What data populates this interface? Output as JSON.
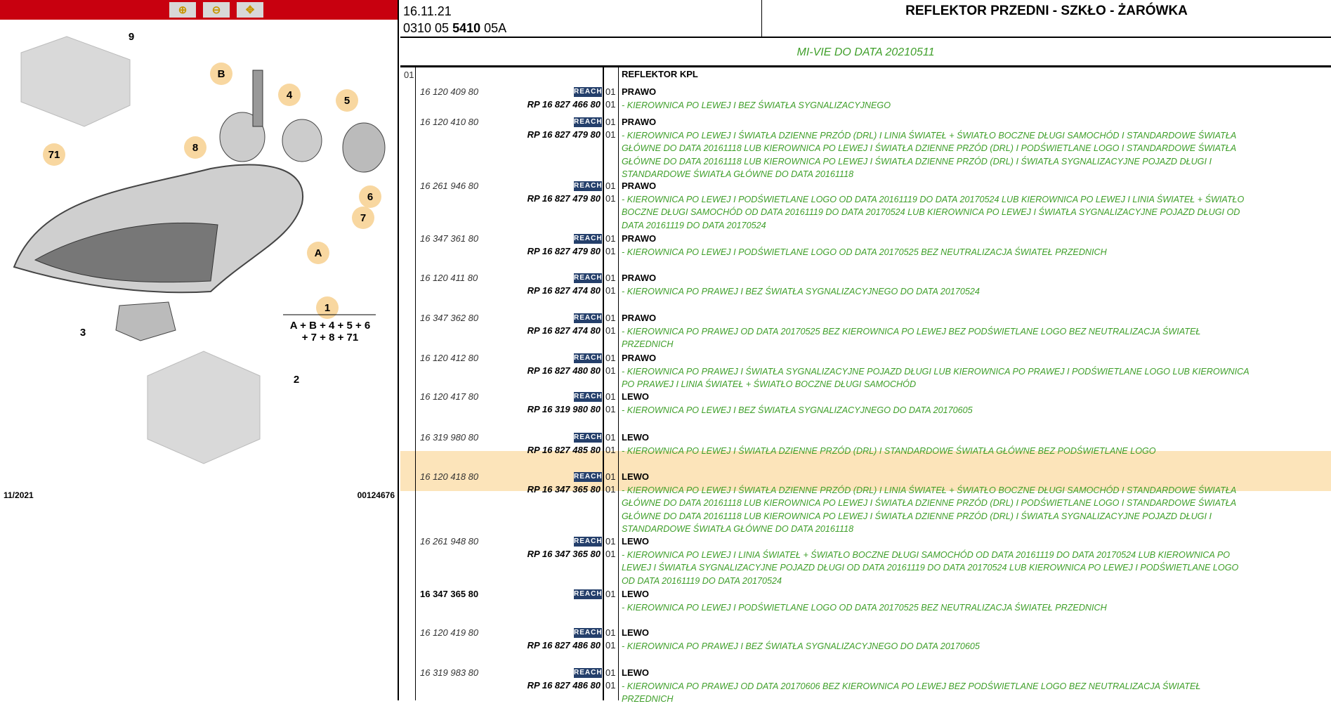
{
  "toolbar": {
    "zoom_in": "zoom-in-icon",
    "zoom_out": "zoom-out-icon",
    "pan": "pan-zoom-icon"
  },
  "diagram": {
    "callouts": [
      "9",
      "B",
      "4",
      "5",
      "71",
      "8",
      "6",
      "7",
      "A",
      "1",
      "3",
      "2"
    ],
    "formula_line1": "A + B + 4 + 5 + 6",
    "formula_line2": "+ 7 + 8 + 71",
    "date": "11/2021",
    "code": "00124676"
  },
  "header": {
    "date": "16.11.21",
    "ref_prefix": "0310 05 ",
    "ref_bold": "5410",
    "ref_suffix": " 05A",
    "title": "REFLEKTOR PRZEDNI - SZKŁO - ŻARÓWKA",
    "subtitle": "MI-VIE DO DATA 20210511"
  },
  "table": {
    "level": "01",
    "group": "REFLEKTOR KPL",
    "reach": "REACH",
    "highlight_color": "#fce4ba",
    "entries": [
      {
        "pn": "16 120 409 80",
        "qty": "01",
        "side": "PRAWO",
        "rp": "RP 16 827 466 80",
        "rqty": "01",
        "desc": [
          "- KIEROWNICA PO LEWEJ I BEZ ŚWIATŁA SYGNALIZACYJNEGO"
        ]
      },
      {
        "pn": "16 120 410 80",
        "qty": "01",
        "side": "PRAWO",
        "rp": "RP 16 827 479 80",
        "rqty": "01",
        "desc": [
          "- KIEROWNICA PO LEWEJ I ŚWIATŁA DZIENNE PRZÓD (DRL) I LINIA ŚWIATEŁ + ŚWIATŁO BOCZNE DŁUGI SAMOCHÓD I STANDARDOWE ŚWIATŁA",
          "GŁÓWNE DO DATA 20161118 LUB KIEROWNICA PO LEWEJ I ŚWIATŁA DZIENNE PRZÓD (DRL) I PODŚWIETLANE LOGO I STANDARDOWE ŚWIATŁA",
          "GŁÓWNE DO DATA 20161118 LUB KIEROWNICA PO LEWEJ I ŚWIATŁA DZIENNE PRZÓD (DRL) I ŚWIATŁA SYGNALIZACYJNE POJAZD DŁUGI I",
          "STANDARDOWE ŚWIATŁA GŁÓWNE DO DATA 20161118"
        ]
      },
      {
        "pn": "16 261 946 80",
        "qty": "01",
        "side": "PRAWO",
        "rp": "RP 16 827 479 80",
        "rqty": "01",
        "desc": [
          "- KIEROWNICA PO LEWEJ I PODŚWIETLANE LOGO OD DATA 20161119 DO DATA 20170524 LUB KIEROWNICA PO LEWEJ I LINIA ŚWIATEŁ + ŚWIATŁO",
          "BOCZNE DŁUGI SAMOCHÓD OD DATA 20161119 DO DATA 20170524 LUB KIEROWNICA PO LEWEJ I ŚWIATŁA SYGNALIZACYJNE POJAZD DŁUGI OD",
          "DATA 20161119 DO DATA 20170524"
        ]
      },
      {
        "pn": "16 347 361 80",
        "qty": "01",
        "side": "PRAWO",
        "rp": "RP 16 827 479 80",
        "rqty": "01",
        "desc": [
          "- KIEROWNICA PO LEWEJ I PODŚWIETLANE LOGO OD DATA 20170525 BEZ NEUTRALIZACJA ŚWIATEŁ PRZEDNICH"
        ]
      },
      {
        "pn": "16 120 411 80",
        "qty": "01",
        "side": "PRAWO",
        "rp": "RP 16 827 474 80",
        "rqty": "01",
        "desc": [
          "- KIEROWNICA PO PRAWEJ I BEZ ŚWIATŁA SYGNALIZACYJNEGO DO DATA 20170524"
        ]
      },
      {
        "pn": "16 347 362 80",
        "qty": "01",
        "side": "PRAWO",
        "rp": "RP 16 827 474 80",
        "rqty": "01",
        "desc": [
          "- KIEROWNICA PO PRAWEJ OD DATA 20170525 BEZ KIEROWNICA PO LEWEJ BEZ PODŚWIETLANE LOGO BEZ NEUTRALIZACJA ŚWIATEŁ",
          "PRZEDNICH"
        ]
      },
      {
        "pn": "16 120 412 80",
        "qty": "01",
        "side": "PRAWO",
        "rp": "RP 16 827 480 80",
        "rqty": "01",
        "desc": [
          "- KIEROWNICA PO PRAWEJ I ŚWIATŁA SYGNALIZACYJNE POJAZD DŁUGI LUB KIEROWNICA PO PRAWEJ I PODŚWIETLANE LOGO LUB KIEROWNICA",
          "PO PRAWEJ I LINIA ŚWIATEŁ + ŚWIATŁO BOCZNE DŁUGI SAMOCHÓD"
        ]
      },
      {
        "pn": "16 120 417 80",
        "qty": "01",
        "side": "LEWO",
        "rp": "RP 16 319 980 80",
        "rqty": "01",
        "desc": [
          "- KIEROWNICA PO LEWEJ I BEZ ŚWIATŁA SYGNALIZACYJNEGO DO DATA 20170605"
        ]
      },
      {
        "pn": "16 319 980 80",
        "qty": "01",
        "side": "LEWO",
        "rp": "RP 16 827 485 80",
        "rqty": "01",
        "desc": [
          "- KIEROWNICA PO LEWEJ I ŚWIATŁA DZIENNE PRZÓD (DRL) I STANDARDOWE ŚWIATŁA GŁÓWNE BEZ PODŚWIETLANE LOGO"
        ]
      },
      {
        "pn": "16 120 418 80",
        "qty": "01",
        "side": "LEWO",
        "rp": "RP 16 347 365 80",
        "rqty": "01",
        "desc": [
          "- KIEROWNICA PO LEWEJ I ŚWIATŁA DZIENNE PRZÓD (DRL) I LINIA ŚWIATEŁ + ŚWIATŁO BOCZNE DŁUGI SAMOCHÓD I STANDARDOWE ŚWIATŁA",
          "GŁÓWNE DO DATA 20161118 LUB KIEROWNICA PO LEWEJ I ŚWIATŁA DZIENNE PRZÓD (DRL) I PODŚWIETLANE LOGO I STANDARDOWE ŚWIATŁA",
          "GŁÓWNE DO DATA 20161118 LUB KIEROWNICA PO LEWEJ I ŚWIATŁA DZIENNE PRZÓD (DRL) I ŚWIATŁA SYGNALIZACYJNE POJAZD DŁUGI I",
          "STANDARDOWE ŚWIATŁA GŁÓWNE DO DATA 20161118"
        ]
      },
      {
        "pn": "16 261 948 80",
        "qty": "01",
        "side": "LEWO",
        "rp": "RP 16 347 365 80",
        "rqty": "01",
        "desc": [
          "- KIEROWNICA PO LEWEJ I LINIA ŚWIATEŁ + ŚWIATŁO BOCZNE DŁUGI SAMOCHÓD OD DATA 20161119 DO DATA 20170524 LUB KIEROWNICA PO",
          "LEWEJ I ŚWIATŁA SYGNALIZACYJNE POJAZD DŁUGI OD DATA 20161119 DO DATA 20170524 LUB KIEROWNICA PO LEWEJ I PODŚWIETLANE LOGO",
          "OD DATA 20161119 DO DATA 20170524"
        ]
      },
      {
        "pn": "16 347 365 80",
        "bold": true,
        "qty": "01",
        "side": "LEWO",
        "rp": "",
        "rqty": "",
        "desc": [
          "- KIEROWNICA PO LEWEJ I PODŚWIETLANE LOGO OD DATA 20170525 BEZ NEUTRALIZACJA ŚWIATEŁ PRZEDNICH"
        ]
      },
      {
        "pn": "16 120 419 80",
        "qty": "01",
        "side": "LEWO",
        "rp": "RP 16 827 486 80",
        "rqty": "01",
        "desc": [
          "- KIEROWNICA PO PRAWEJ I BEZ ŚWIATŁA SYGNALIZACYJNEGO DO DATA 20170605"
        ]
      },
      {
        "pn": "16 319 983 80",
        "qty": "01",
        "side": "LEWO",
        "rp": "RP 16 827 486 80",
        "rqty": "01",
        "desc": [
          "- KIEROWNICA PO PRAWEJ OD DATA 20170606 BEZ KIEROWNICA PO LEWEJ BEZ PODŚWIETLANE LOGO BEZ NEUTRALIZACJA ŚWIATEŁ",
          "PRZEDNICH"
        ]
      }
    ]
  }
}
